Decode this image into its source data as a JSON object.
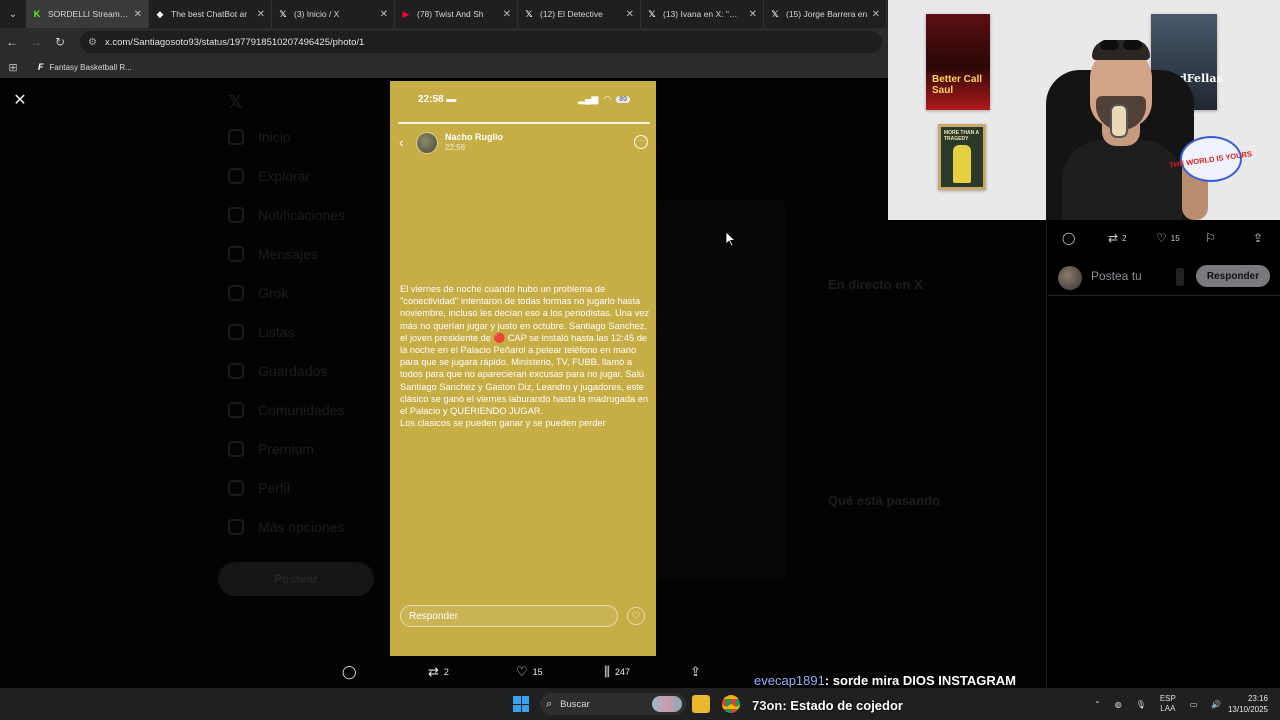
{
  "browser": {
    "tabs": [
      {
        "title": "SORDELLI Stream - V",
        "icon": "kick-icon",
        "color": "#53fc18",
        "glyph": "K"
      },
      {
        "title": "The best ChatBot ar",
        "icon": "chatbot-icon",
        "color": "#ffffff",
        "glyph": "◆"
      },
      {
        "title": "(3) Inicio / X",
        "icon": "x-icon",
        "color": "#ffffff",
        "glyph": "𝕏"
      },
      {
        "title": "(78) Twist And Sh",
        "icon": "youtube-icon",
        "color": "#ff0033",
        "glyph": "▶"
      },
      {
        "title": "(12) El Detective",
        "icon": "x-icon",
        "color": "#ffffff",
        "glyph": "𝕏"
      },
      {
        "title": "(13) Ivana en X: \"@Sc",
        "icon": "x-icon",
        "color": "#ffffff",
        "glyph": "𝕏"
      },
      {
        "title": "(15) Jorge Barrera en",
        "icon": "x-icon",
        "color": "#ffffff",
        "glyph": "𝕏"
      }
    ],
    "url": "x.com/Santiagosoto93/status/1977918510207496425/photo/1",
    "bookmark": "Fantasy Basketball R..."
  },
  "x_background": {
    "nav": [
      "Inicio",
      "Explorar",
      "Notificaciones",
      "Mensajes",
      "Grok",
      "Listas",
      "Guardados",
      "Comunidades",
      "Premium",
      "Perfil",
      "Más opciones"
    ],
    "post_button": "Postear",
    "right_headers": [
      "En directo en X",
      "Qué está pasando"
    ]
  },
  "story": {
    "status_time": "22:58",
    "battery": "80",
    "username": "Nacho Ruglio",
    "post_time": "22:58",
    "paragraphs": [
      "El viernes de noche cuando hubo un problema de \"conectividad\" intentaron de todas formas no jugarlo hasta noviembre, incluso les decían eso a los periodistas. Una vez más no querían jugar y justo en octubre. Santiago Sanchez, el joven presidente de 🔴 CAP se instaló hasta las 12:45 de la noche en el Palacio Peñarol a pelear teléfono en mano para que se jugara rápido. Ministerio, TV, FUBB, llamó a todos para que no aparecieran excusas para no jugar.  Salú Santiago Sanchez y Gaston Diz, Leandro y jugadores, este clásico se ganó el viernes laburando hasta la madrugada en el Palacio y QUERIENDO JUGAR.",
      "Los clasicos se pueden ganar y se pueden perder"
    ],
    "reply_placeholder": "Responder"
  },
  "actions_bottom": {
    "retweets": "2",
    "likes": "15",
    "views": "247"
  },
  "actions_right": {
    "retweets": "2",
    "likes": "15"
  },
  "reply_box": {
    "placeholder": "Postea tu",
    "button": "Responder"
  },
  "webcam": {
    "poster1_text": "Better Call Saul",
    "poster2_text": "GoodFellas",
    "poster3_text": "MORE THAN A TRAGEDY",
    "badge_text": "THE WORLD IS YOURS"
  },
  "chat": [
    {
      "user": "evecap1891",
      "message": ": sorde mira DIOS INSTAGRAM"
    },
    {
      "user": "73on",
      "message": ": Estado de cojedor"
    }
  ],
  "taskbar": {
    "search": "Buscar",
    "lang_top": "ESP",
    "lang_bottom": "LAA",
    "time": "23:16",
    "date": "13/10/2025"
  }
}
